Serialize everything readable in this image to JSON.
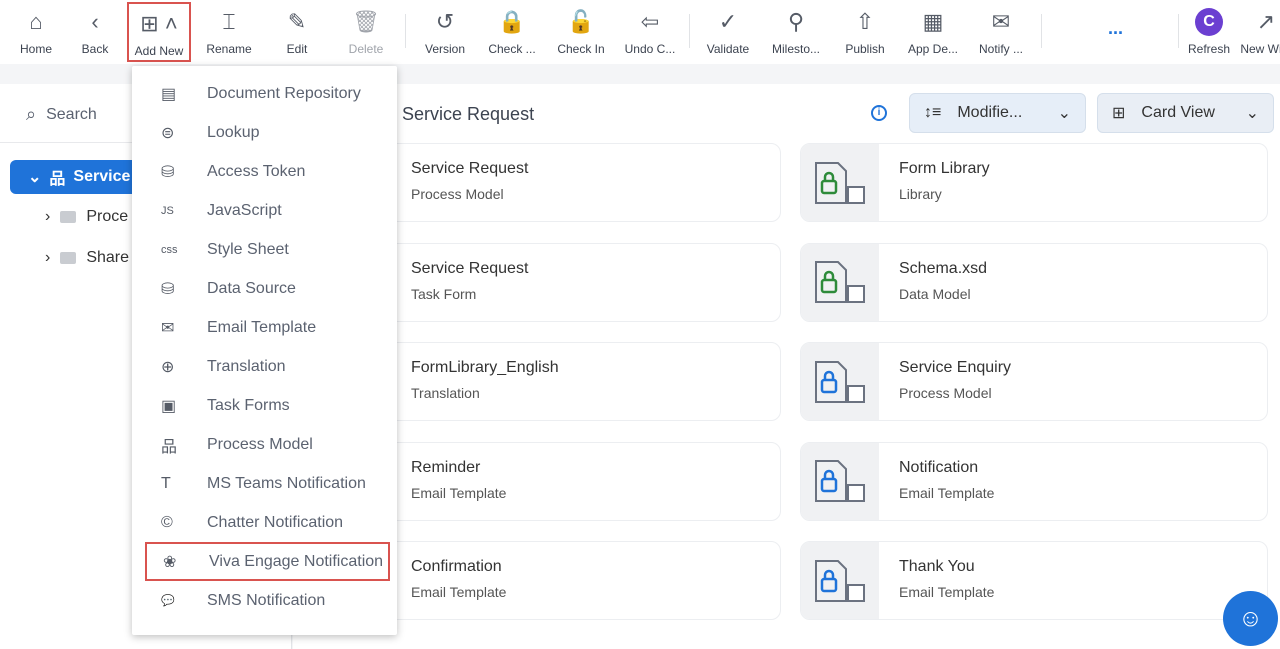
{
  "toolbar": {
    "items": [
      {
        "label": "Home",
        "icon": "home-icon",
        "glyph": "⌂"
      },
      {
        "label": "Back",
        "icon": "back-icon",
        "glyph": "‹"
      },
      {
        "label": "Add New",
        "icon": "add-new-icon",
        "glyph": "⊞ ˄"
      },
      {
        "label": "Rename",
        "icon": "rename-icon",
        "glyph": "⌶"
      },
      {
        "label": "Edit",
        "icon": "edit-icon",
        "glyph": "✎"
      },
      {
        "label": "Delete",
        "icon": "delete-icon",
        "glyph": "🗑"
      },
      {
        "label": "Version",
        "icon": "version-icon",
        "glyph": "↺"
      },
      {
        "label": "Check ...",
        "icon": "lock-icon",
        "glyph": "🔒"
      },
      {
        "label": "Check In",
        "icon": "unlock-icon",
        "glyph": "🔓"
      },
      {
        "label": "Undo C...",
        "icon": "undo-checkout-icon",
        "glyph": "⇦"
      },
      {
        "label": "Validate",
        "icon": "validate-icon",
        "glyph": "✓"
      },
      {
        "label": "Milesto...",
        "icon": "milestone-icon",
        "glyph": "⚲"
      },
      {
        "label": "Publish",
        "icon": "publish-icon",
        "glyph": "⇧"
      },
      {
        "label": "App De...",
        "icon": "app-designer-icon",
        "glyph": "▦"
      },
      {
        "label": "Notify ...",
        "icon": "mail-icon",
        "glyph": "✉"
      },
      {
        "label": "Refresh",
        "icon": "refresh-icon",
        "glyph": "C"
      },
      {
        "label": "New Wi...",
        "icon": "new-window-icon",
        "glyph": "↗"
      }
    ],
    "more": "..."
  },
  "sidebar": {
    "search_label": "Search",
    "tree": {
      "root": "Service",
      "children": [
        "Proce",
        "Share"
      ]
    }
  },
  "main": {
    "title": "Service Request",
    "sort_label": "Modifie...",
    "view_label": "Card View",
    "cards_left": [
      {
        "title": "Service Request",
        "subtitle": "Process Model"
      },
      {
        "title": "Service Request",
        "subtitle": "Task Form"
      },
      {
        "title": "FormLibrary_English",
        "subtitle": "Translation"
      },
      {
        "title": "Reminder",
        "subtitle": "Email Template"
      },
      {
        "title": "Confirmation",
        "subtitle": "Email Template"
      }
    ],
    "cards_right": [
      {
        "title": "Form Library",
        "subtitle": "Library",
        "lock_color": "#2e8b3a"
      },
      {
        "title": "Schema.xsd",
        "subtitle": "Data Model",
        "lock_color": "#2e8b3a"
      },
      {
        "title": "Service Enquiry",
        "subtitle": "Process Model",
        "lock_color": "#1f73d9"
      },
      {
        "title": "Notification",
        "subtitle": "Email Template",
        "lock_color": "#1f73d9"
      },
      {
        "title": "Thank You",
        "subtitle": "Email Template",
        "lock_color": "#1f73d9"
      }
    ]
  },
  "menu": {
    "items": [
      {
        "label": "Document Repository",
        "glyph": "▤"
      },
      {
        "label": "Lookup",
        "glyph": "⊜"
      },
      {
        "label": "Access Token",
        "glyph": "⛁"
      },
      {
        "label": "JavaScript",
        "glyph": "JS"
      },
      {
        "label": "Style Sheet",
        "glyph": "css"
      },
      {
        "label": "Data Source",
        "glyph": "⛁"
      },
      {
        "label": "Email Template",
        "glyph": "✉"
      },
      {
        "label": "Translation",
        "glyph": "⊕"
      },
      {
        "label": "Task Forms",
        "glyph": "▣"
      },
      {
        "label": "Process Model",
        "glyph": "品"
      },
      {
        "label": "MS Teams Notification",
        "glyph": "T"
      },
      {
        "label": "Chatter Notification",
        "glyph": "©"
      },
      {
        "label": "Viva Engage Notification",
        "glyph": "❀"
      },
      {
        "label": "SMS Notification",
        "glyph": "💬"
      }
    ],
    "highlighted": "Viva Engage Notification"
  },
  "colors": {
    "accent": "#1f73d9",
    "highlight_border": "#d9534f",
    "refresh": "#6b3fd1"
  }
}
